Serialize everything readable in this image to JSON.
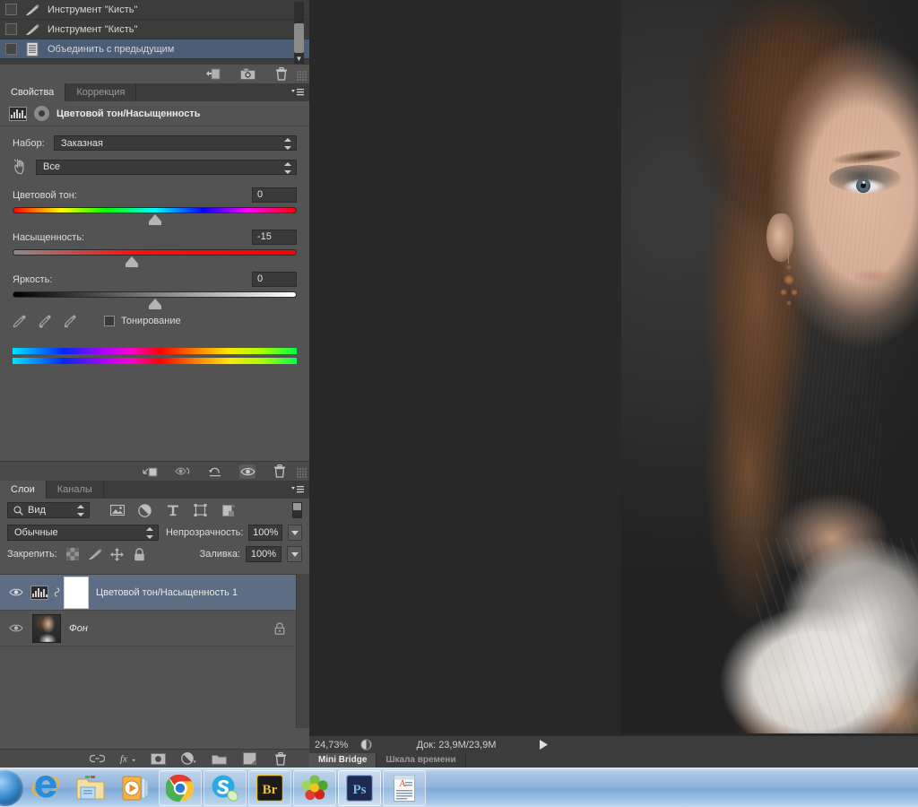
{
  "app": {
    "name": "Adobe Photoshop",
    "locale": "ru"
  },
  "history_panel": {
    "rows": [
      {
        "label": "Инструмент \"Кисть\"",
        "icon": "brush-icon",
        "selected": false
      },
      {
        "label": "Инструмент \"Кисть\"",
        "icon": "brush-icon",
        "selected": false
      },
      {
        "label": "Объединить с предыдущим",
        "icon": "document-icon",
        "selected": true
      }
    ],
    "buttons": [
      {
        "name": "new-document-from-state-button",
        "icon": "new-doc-icon"
      },
      {
        "name": "new-snapshot-button",
        "icon": "camera-icon"
      },
      {
        "name": "delete-state-button",
        "icon": "trash-icon"
      }
    ]
  },
  "properties_panel": {
    "tabs": [
      {
        "label": "Свойства",
        "active": true
      },
      {
        "label": "Коррекция",
        "active": false
      }
    ],
    "menu_icon": "panel-menu-icon",
    "title": "Цветовой тон/Насыщенность",
    "preset": {
      "label": "Набор:",
      "value": "Заказная"
    },
    "channel": {
      "value": "Все",
      "hand_icon": "targeted-adjustment-icon"
    },
    "sliders": [
      {
        "name": "hue",
        "label": "Цветовой тон:",
        "value": "0",
        "position_pct": 50,
        "track": "hue"
      },
      {
        "name": "saturation",
        "label": "Насыщенность:",
        "value": "-15",
        "position_pct": 42,
        "track": "sat"
      },
      {
        "name": "lightness",
        "label": "Яркость:",
        "value": "0",
        "position_pct": 50,
        "track": "lig"
      }
    ],
    "eyedroppers": [
      {
        "name": "eyedropper-tool",
        "icon": "eyedropper-icon"
      },
      {
        "name": "eyedropper-add-tool",
        "icon": "eyedropper-plus-icon"
      },
      {
        "name": "eyedropper-sub-tool",
        "icon": "eyedropper-minus-icon"
      }
    ],
    "colorize": {
      "label": "Тонирование",
      "checked": false
    },
    "gradient_bars": 2,
    "footer_buttons": [
      {
        "name": "clip-to-layer-button",
        "icon": "clip-layer-icon",
        "active": false
      },
      {
        "name": "view-previous-state-button",
        "icon": "eye-previous-icon",
        "active": false
      },
      {
        "name": "reset-button",
        "icon": "reset-icon",
        "active": false
      },
      {
        "name": "toggle-visibility-button",
        "icon": "eye-icon",
        "active": true
      },
      {
        "name": "delete-adjustment-button",
        "icon": "trash-icon",
        "active": false
      }
    ]
  },
  "layers_panel": {
    "tabs": [
      {
        "label": "Слои",
        "active": true
      },
      {
        "label": "Каналы",
        "active": false
      }
    ],
    "menu_icon": "panel-menu-icon",
    "filter": {
      "value": "Вид",
      "search_icon": "search-icon"
    },
    "filter_type_icons": [
      {
        "name": "filter-pixel-icon",
        "icon": "image-icon"
      },
      {
        "name": "filter-adjustment-icon",
        "icon": "half-circle-icon"
      },
      {
        "name": "filter-type-icon",
        "icon": "text-T-icon"
      },
      {
        "name": "filter-shape-icon",
        "icon": "shape-icon"
      },
      {
        "name": "filter-smart-object-icon",
        "icon": "smart-object-icon"
      }
    ],
    "blend_mode": "Обычные",
    "opacity": {
      "label": "Непрозрачность:",
      "value": "100%"
    },
    "lock": {
      "label": "Закрепить:",
      "icons": [
        {
          "name": "lock-transparency-icon",
          "icon": "checker-icon"
        },
        {
          "name": "lock-image-icon",
          "icon": "brush-icon"
        },
        {
          "name": "lock-position-icon",
          "icon": "move-icon"
        },
        {
          "name": "lock-all-icon",
          "icon": "lock-icon"
        }
      ]
    },
    "fill": {
      "label": "Заливка:",
      "value": "100%"
    },
    "layers": [
      {
        "name": "Цветовой тон/Насыщенность 1",
        "selected": true,
        "visible": true,
        "has_adjustment_thumb": true,
        "has_link": true,
        "has_mask": true,
        "locked": false,
        "italic": false
      },
      {
        "name": "Фон",
        "selected": false,
        "visible": true,
        "has_adjustment_thumb": false,
        "has_link": false,
        "has_mask": false,
        "locked": true,
        "italic": true
      }
    ],
    "footer_buttons": [
      {
        "name": "link-layers-button",
        "icon": "link-icon"
      },
      {
        "name": "layer-style-button",
        "icon": "fx-icon"
      },
      {
        "name": "add-mask-button",
        "icon": "mask-icon"
      },
      {
        "name": "new-fill-adjustment-button",
        "icon": "half-circle-icon"
      },
      {
        "name": "new-group-button",
        "icon": "folder-icon"
      },
      {
        "name": "new-layer-button",
        "icon": "new-layer-icon"
      },
      {
        "name": "delete-layer-button",
        "icon": "trash-icon"
      }
    ]
  },
  "status_bar": {
    "zoom": "24,73%",
    "doc_icon": "document-profile-icon",
    "doc_info": "Док: 23,9M/23,9M",
    "arrow_icon": "play-arrow-icon"
  },
  "bottom_tabs": [
    {
      "label": "Mini Bridge",
      "active": true
    },
    {
      "label": "Шкала времени",
      "active": false
    }
  ],
  "taskbar": {
    "start": {
      "name": "start-orb",
      "icon": "windows-orb-icon"
    },
    "items": [
      {
        "name": "taskbar-internet-explorer",
        "icon": "internet-explorer-icon",
        "state": "pinned-flat"
      },
      {
        "name": "taskbar-explorer",
        "icon": "folder-explorer-icon",
        "state": "pinned-flat"
      },
      {
        "name": "taskbar-media-player",
        "icon": "media-player-icon",
        "state": "pinned-flat"
      },
      {
        "name": "taskbar-chrome",
        "icon": "chrome-icon",
        "state": "pinned"
      },
      {
        "name": "taskbar-skype",
        "icon": "skype-icon",
        "state": "pinned"
      },
      {
        "name": "taskbar-bridge",
        "icon": "adobe-bridge-icon",
        "state": "pinned"
      },
      {
        "name": "taskbar-icq",
        "icon": "icq-flower-icon",
        "state": "pinned"
      },
      {
        "name": "taskbar-photoshop",
        "icon": "photoshop-icon",
        "state": "active"
      },
      {
        "name": "taskbar-document",
        "icon": "text-document-icon",
        "state": "pinned"
      }
    ]
  },
  "colors": {
    "panel_bg": "#535353",
    "panel_dark": "#3c3c3c",
    "canvas_bg": "#282828",
    "selection_blue": "#4c5d76",
    "layer_selection_blue": "#5d6d84",
    "field_bg": "#3a3a3a",
    "text": "#d4d4d4"
  }
}
